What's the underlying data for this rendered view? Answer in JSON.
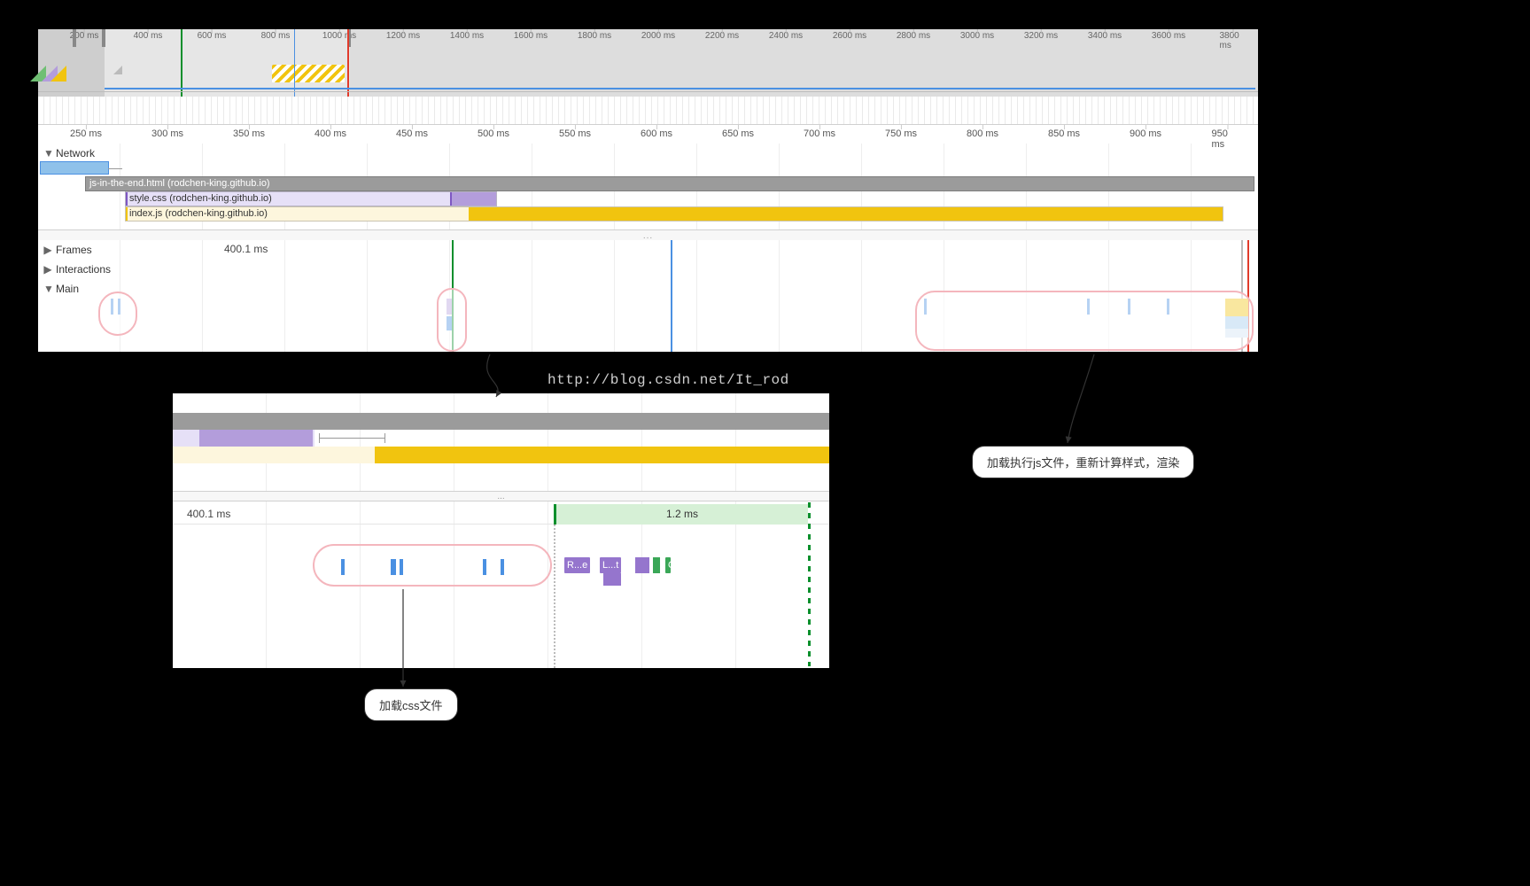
{
  "overview": {
    "ticks": [
      "200 ms",
      "400 ms",
      "600 ms",
      "800 ms",
      "1000 ms",
      "1200 ms",
      "1400 ms",
      "1600 ms",
      "1800 ms",
      "2000 ms",
      "2200 ms",
      "2400 ms",
      "2600 ms",
      "2800 ms",
      "3000 ms",
      "3200 ms",
      "3400 ms",
      "3600 ms",
      "3800 ms"
    ]
  },
  "detail_ruler": {
    "ticks": [
      "250 ms",
      "300 ms",
      "350 ms",
      "400 ms",
      "450 ms",
      "500 ms",
      "550 ms",
      "600 ms",
      "650 ms",
      "700 ms",
      "750 ms",
      "800 ms",
      "850 ms",
      "900 ms",
      "950 ms"
    ]
  },
  "sections": {
    "network": "Network",
    "frames": "Frames",
    "interactions": "Interactions",
    "main": "Main"
  },
  "requests": {
    "html": "js-in-the-end.html (rodchen-king.github.io)",
    "css": "style.css (rodchen-king.github.io)",
    "js": "index.js (rodchen-king.github.io)"
  },
  "frames_row": {
    "t1": "400.1 ms"
  },
  "watermark": "http://blog.csdn.net/It_rod",
  "zoom": {
    "t_left": "400.1 ms",
    "t_frame": "1.2 ms",
    "chips": {
      "re": "R...e",
      "lt": "L...t",
      "c": "C..."
    }
  },
  "callouts": {
    "js": "加载执行js文件，重新计算样式，渲染",
    "css": "加载css文件"
  },
  "divider": "..."
}
